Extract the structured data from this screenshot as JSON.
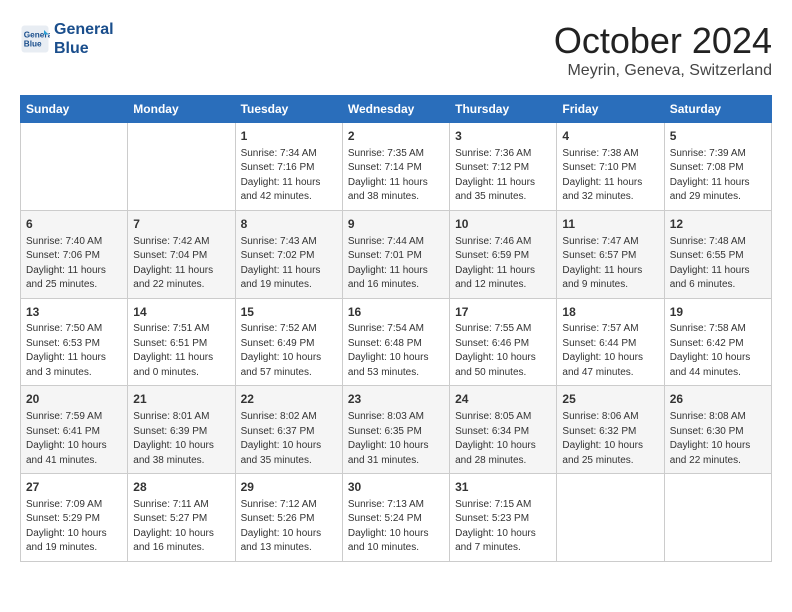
{
  "logo": {
    "line1": "General",
    "line2": "Blue"
  },
  "title": "October 2024",
  "location": "Meyrin, Geneva, Switzerland",
  "days_of_week": [
    "Sunday",
    "Monday",
    "Tuesday",
    "Wednesday",
    "Thursday",
    "Friday",
    "Saturday"
  ],
  "weeks": [
    [
      {
        "day": null,
        "info": null
      },
      {
        "day": null,
        "info": null
      },
      {
        "day": "1",
        "info": "Sunrise: 7:34 AM\nSunset: 7:16 PM\nDaylight: 11 hours and 42 minutes."
      },
      {
        "day": "2",
        "info": "Sunrise: 7:35 AM\nSunset: 7:14 PM\nDaylight: 11 hours and 38 minutes."
      },
      {
        "day": "3",
        "info": "Sunrise: 7:36 AM\nSunset: 7:12 PM\nDaylight: 11 hours and 35 minutes."
      },
      {
        "day": "4",
        "info": "Sunrise: 7:38 AM\nSunset: 7:10 PM\nDaylight: 11 hours and 32 minutes."
      },
      {
        "day": "5",
        "info": "Sunrise: 7:39 AM\nSunset: 7:08 PM\nDaylight: 11 hours and 29 minutes."
      }
    ],
    [
      {
        "day": "6",
        "info": "Sunrise: 7:40 AM\nSunset: 7:06 PM\nDaylight: 11 hours and 25 minutes."
      },
      {
        "day": "7",
        "info": "Sunrise: 7:42 AM\nSunset: 7:04 PM\nDaylight: 11 hours and 22 minutes."
      },
      {
        "day": "8",
        "info": "Sunrise: 7:43 AM\nSunset: 7:02 PM\nDaylight: 11 hours and 19 minutes."
      },
      {
        "day": "9",
        "info": "Sunrise: 7:44 AM\nSunset: 7:01 PM\nDaylight: 11 hours and 16 minutes."
      },
      {
        "day": "10",
        "info": "Sunrise: 7:46 AM\nSunset: 6:59 PM\nDaylight: 11 hours and 12 minutes."
      },
      {
        "day": "11",
        "info": "Sunrise: 7:47 AM\nSunset: 6:57 PM\nDaylight: 11 hours and 9 minutes."
      },
      {
        "day": "12",
        "info": "Sunrise: 7:48 AM\nSunset: 6:55 PM\nDaylight: 11 hours and 6 minutes."
      }
    ],
    [
      {
        "day": "13",
        "info": "Sunrise: 7:50 AM\nSunset: 6:53 PM\nDaylight: 11 hours and 3 minutes."
      },
      {
        "day": "14",
        "info": "Sunrise: 7:51 AM\nSunset: 6:51 PM\nDaylight: 11 hours and 0 minutes."
      },
      {
        "day": "15",
        "info": "Sunrise: 7:52 AM\nSunset: 6:49 PM\nDaylight: 10 hours and 57 minutes."
      },
      {
        "day": "16",
        "info": "Sunrise: 7:54 AM\nSunset: 6:48 PM\nDaylight: 10 hours and 53 minutes."
      },
      {
        "day": "17",
        "info": "Sunrise: 7:55 AM\nSunset: 6:46 PM\nDaylight: 10 hours and 50 minutes."
      },
      {
        "day": "18",
        "info": "Sunrise: 7:57 AM\nSunset: 6:44 PM\nDaylight: 10 hours and 47 minutes."
      },
      {
        "day": "19",
        "info": "Sunrise: 7:58 AM\nSunset: 6:42 PM\nDaylight: 10 hours and 44 minutes."
      }
    ],
    [
      {
        "day": "20",
        "info": "Sunrise: 7:59 AM\nSunset: 6:41 PM\nDaylight: 10 hours and 41 minutes."
      },
      {
        "day": "21",
        "info": "Sunrise: 8:01 AM\nSunset: 6:39 PM\nDaylight: 10 hours and 38 minutes."
      },
      {
        "day": "22",
        "info": "Sunrise: 8:02 AM\nSunset: 6:37 PM\nDaylight: 10 hours and 35 minutes."
      },
      {
        "day": "23",
        "info": "Sunrise: 8:03 AM\nSunset: 6:35 PM\nDaylight: 10 hours and 31 minutes."
      },
      {
        "day": "24",
        "info": "Sunrise: 8:05 AM\nSunset: 6:34 PM\nDaylight: 10 hours and 28 minutes."
      },
      {
        "day": "25",
        "info": "Sunrise: 8:06 AM\nSunset: 6:32 PM\nDaylight: 10 hours and 25 minutes."
      },
      {
        "day": "26",
        "info": "Sunrise: 8:08 AM\nSunset: 6:30 PM\nDaylight: 10 hours and 22 minutes."
      }
    ],
    [
      {
        "day": "27",
        "info": "Sunrise: 7:09 AM\nSunset: 5:29 PM\nDaylight: 10 hours and 19 minutes."
      },
      {
        "day": "28",
        "info": "Sunrise: 7:11 AM\nSunset: 5:27 PM\nDaylight: 10 hours and 16 minutes."
      },
      {
        "day": "29",
        "info": "Sunrise: 7:12 AM\nSunset: 5:26 PM\nDaylight: 10 hours and 13 minutes."
      },
      {
        "day": "30",
        "info": "Sunrise: 7:13 AM\nSunset: 5:24 PM\nDaylight: 10 hours and 10 minutes."
      },
      {
        "day": "31",
        "info": "Sunrise: 7:15 AM\nSunset: 5:23 PM\nDaylight: 10 hours and 7 minutes."
      },
      {
        "day": null,
        "info": null
      },
      {
        "day": null,
        "info": null
      }
    ]
  ]
}
